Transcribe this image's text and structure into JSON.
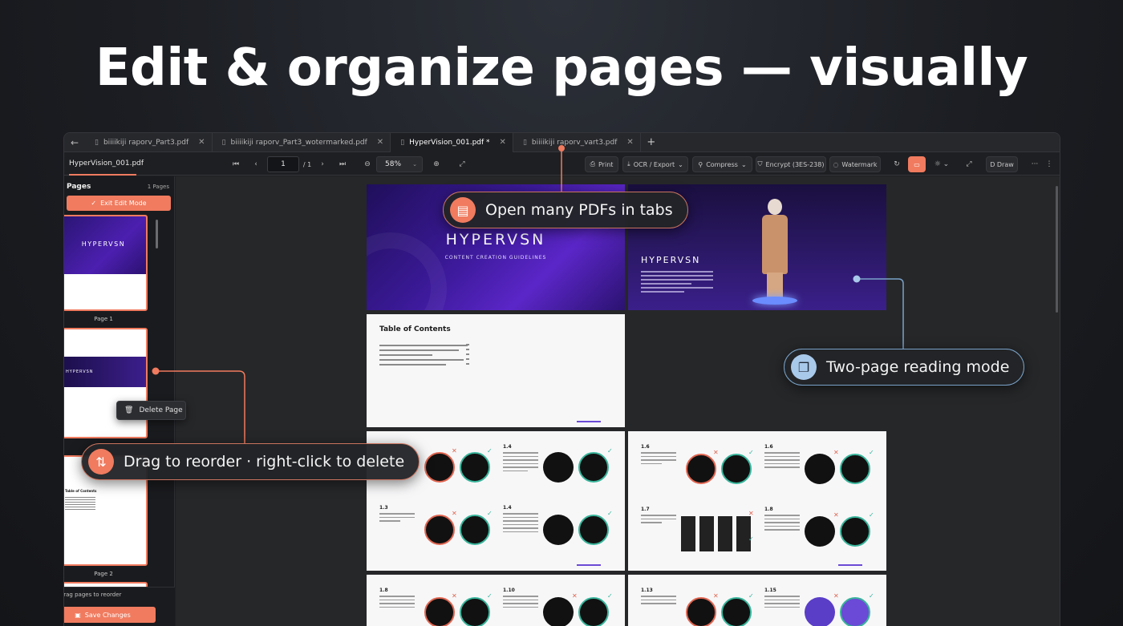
{
  "headline": "Edit & organize pages — visually",
  "tabs": [
    {
      "label": "biiiikiji raporv_Part3.pdf",
      "active": false
    },
    {
      "label": "biiiikiji raporv_Part3_wotermarked.pdf",
      "active": false
    },
    {
      "label": "HyperVision_001.pdf *",
      "active": true
    },
    {
      "label": "biiiikiji raporv_vart3.pdf",
      "active": false
    }
  ],
  "toolbar": {
    "doc_name": "HyperVision_001.pdf",
    "page_value": "1",
    "page_total": "/ 1",
    "zoom_value": "58%",
    "print_label": "Print",
    "ocr_label": "OCR / Export",
    "compress_label": "Compress",
    "encrypt_label": "Encrypt (3ES-238)",
    "watermark_label": "Watermark",
    "draw_label": "D Draw",
    "more_label": "···"
  },
  "sidebar": {
    "title": "Pages",
    "count": "1 Pages",
    "exit_label": "Exit Edit Mode",
    "thumbs": [
      {
        "label": "Page 1",
        "brand": "HYPERVSN"
      },
      {
        "label": "",
        "brand": "HYPERVSN"
      },
      {
        "label": "Page 2",
        "title": "Table of Contents"
      }
    ],
    "drag_hint": "Drag pages to reorder",
    "save_label": "Save Changes"
  },
  "context_menu": {
    "delete_label": "Delete Page"
  },
  "document": {
    "cover_brand": "HYPERVSN",
    "cover_sub": "CONTENT CREATION GUIDELINES",
    "cover2_brand": "HYPERVSN",
    "toc_title": "Table of Contents",
    "sections": [
      "1.4",
      "1.3",
      "1.4",
      "1.6",
      "1.6",
      "1.7",
      "1.8",
      "1.8",
      "1.10",
      "1.13",
      "1.15"
    ]
  },
  "callouts": {
    "tabs": "Open many PDFs in tabs",
    "reading": "Two-page reading mode",
    "reorder": "Drag to reorder · right-click to delete"
  },
  "colors": {
    "accent": "#f07b5f",
    "reading_accent": "#7aa3c9"
  }
}
